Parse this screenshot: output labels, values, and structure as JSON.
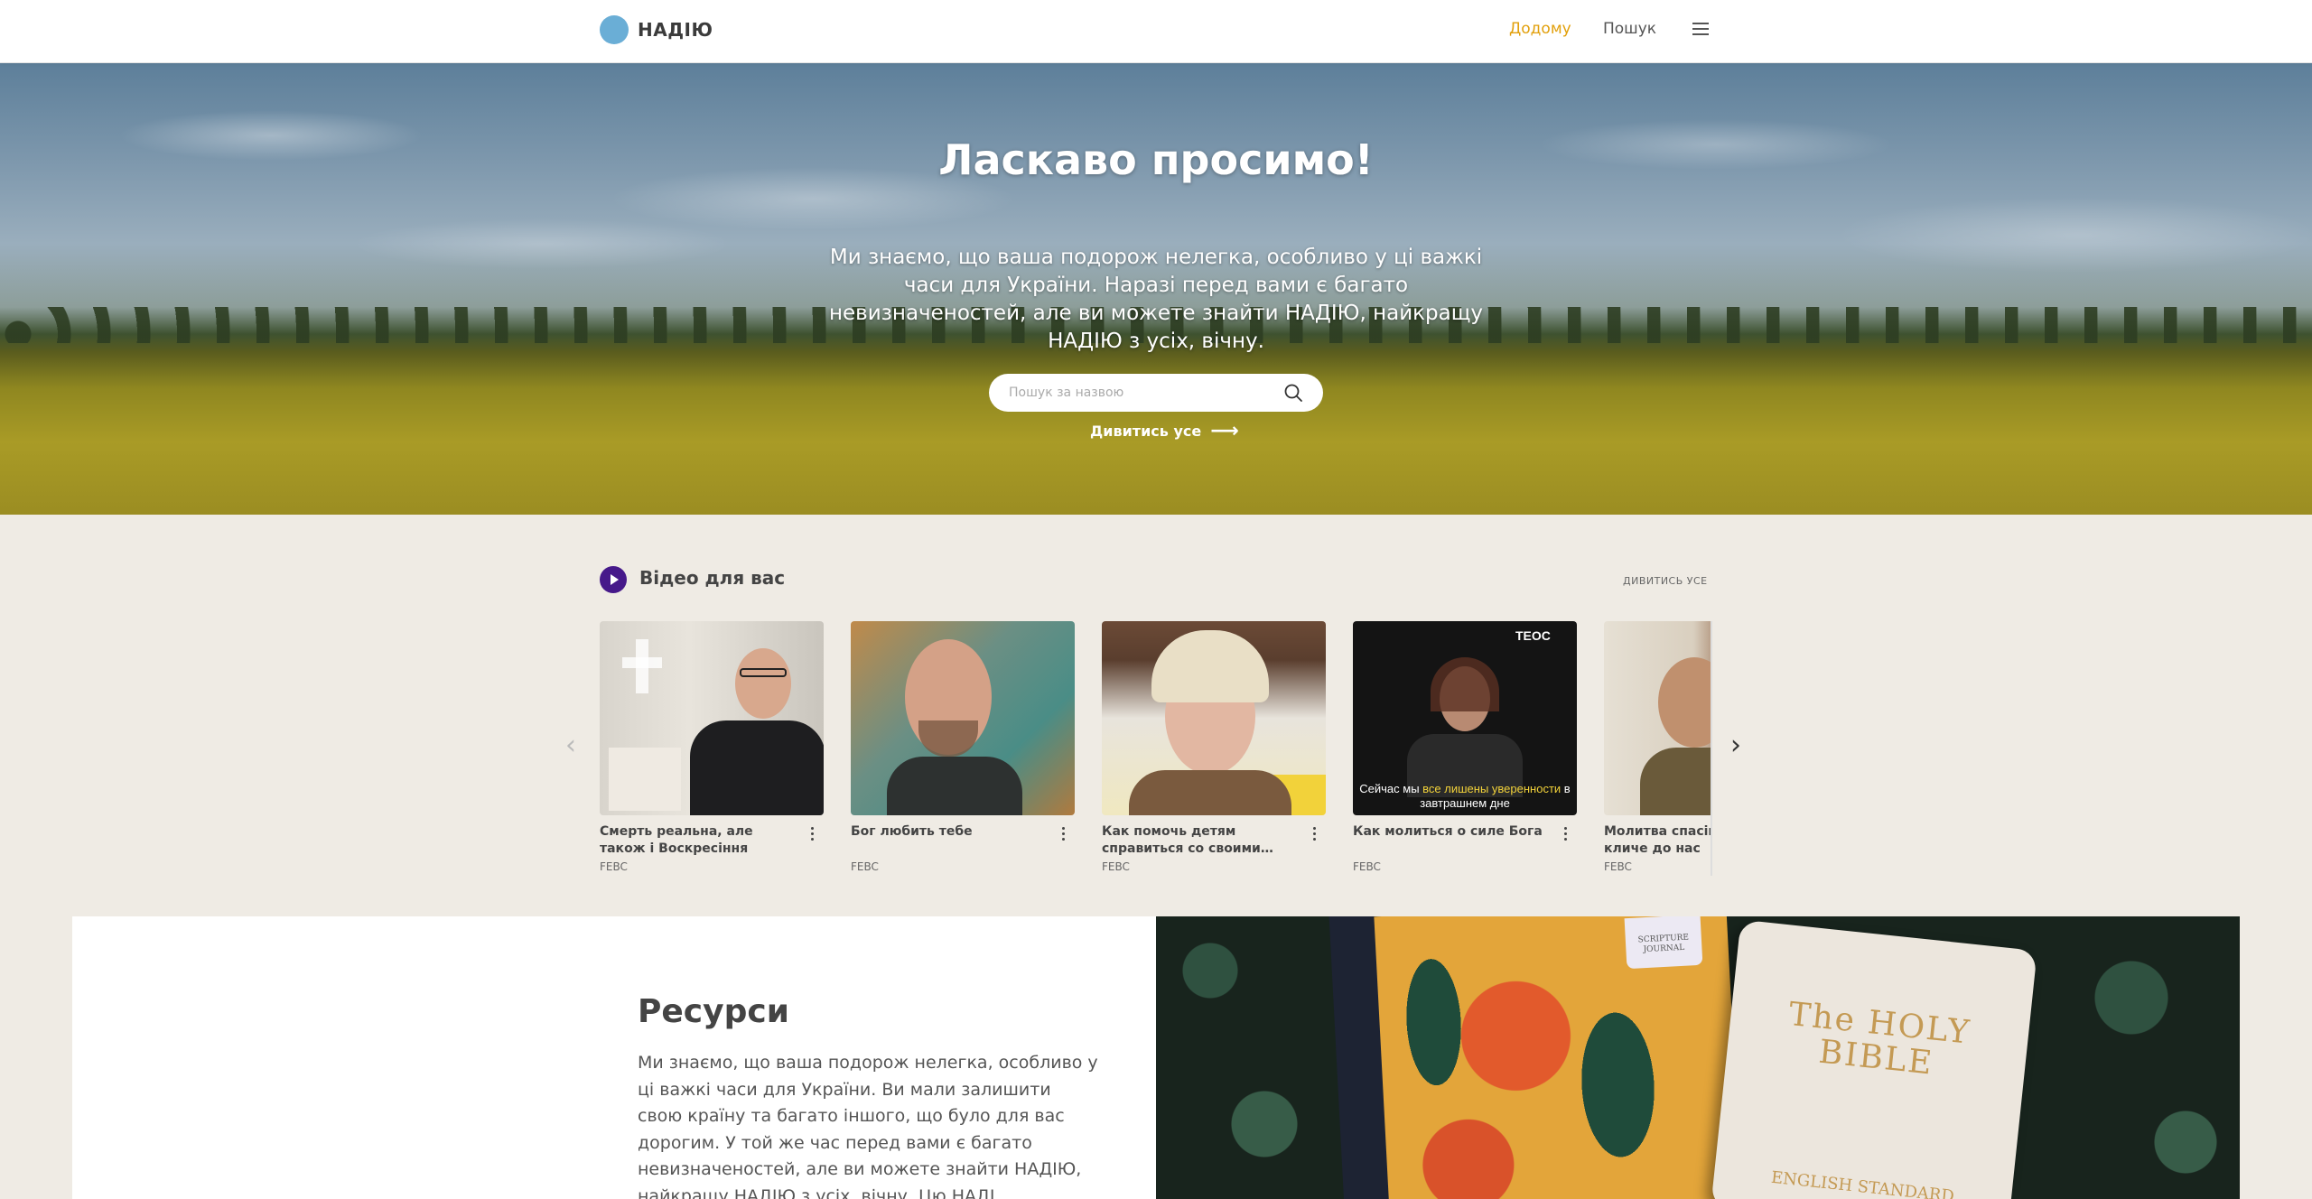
{
  "nav": {
    "logo_text": "НАДІЮ",
    "home_label": "Додому",
    "search_label": "Пошук",
    "menu_icon": "hamburger-menu-icon",
    "accent_color": "#e2a00c"
  },
  "hero": {
    "title": "Ласкаво просимо!",
    "text": "Ми знаємо, що ваша подорож нелегка, особливо у ці важкі часи для України. Наразі перед вами є багато невизначеностей, але ви можете знайти НАДІЮ, найкращу НАДІЮ з усіх, вічну.",
    "search_placeholder": "Пошук за назвою",
    "see_all_label": "Дивитись усе",
    "see_all_arrow": "⟶"
  },
  "videos": {
    "title": "Відео для вас",
    "see_all_label": "ДИВИТИСЬ УСЕ",
    "icon_color": "#46198a",
    "prev_glyph": "‹",
    "next_glyph": "›",
    "items": [
      {
        "title": "Смерть реальна, але також і Воскресіння",
        "source": "FEBC"
      },
      {
        "title": "Бог любить тебе",
        "source": "FEBC"
      },
      {
        "title": "Как помочь детям справиться со своими…",
        "source": "FEBC"
      },
      {
        "title": "Как молиться о силе Бога",
        "source": "FEBC",
        "overlay_brand": "ТЕОС",
        "caption_plain": "Сейчас мы ",
        "caption_highlight": "все лишены уверенности",
        "caption_end": " в завтрашнем дне"
      },
      {
        "title": "Молитва спасіння — Бог кличе до нас",
        "source": "FEBC"
      }
    ]
  },
  "resources": {
    "title": "Ресурси",
    "text": "Ми знаємо, що ваша подорож нелегка, особливо у ці важкі часи для України. Ви мали залишити свою країну та багато іншого, що було для вас дорогим. У той же час перед вами є багато невизначеностей, але ви можете знайти НАДІЮ, найкращу НАДІЮ з усіх, вічну. Цю НАДІ…",
    "journal_tag": "SCRIPTURE JOURNAL",
    "bible_title": "The HOLY BIBLE",
    "bible_sub": "ENGLISH STANDARD"
  }
}
